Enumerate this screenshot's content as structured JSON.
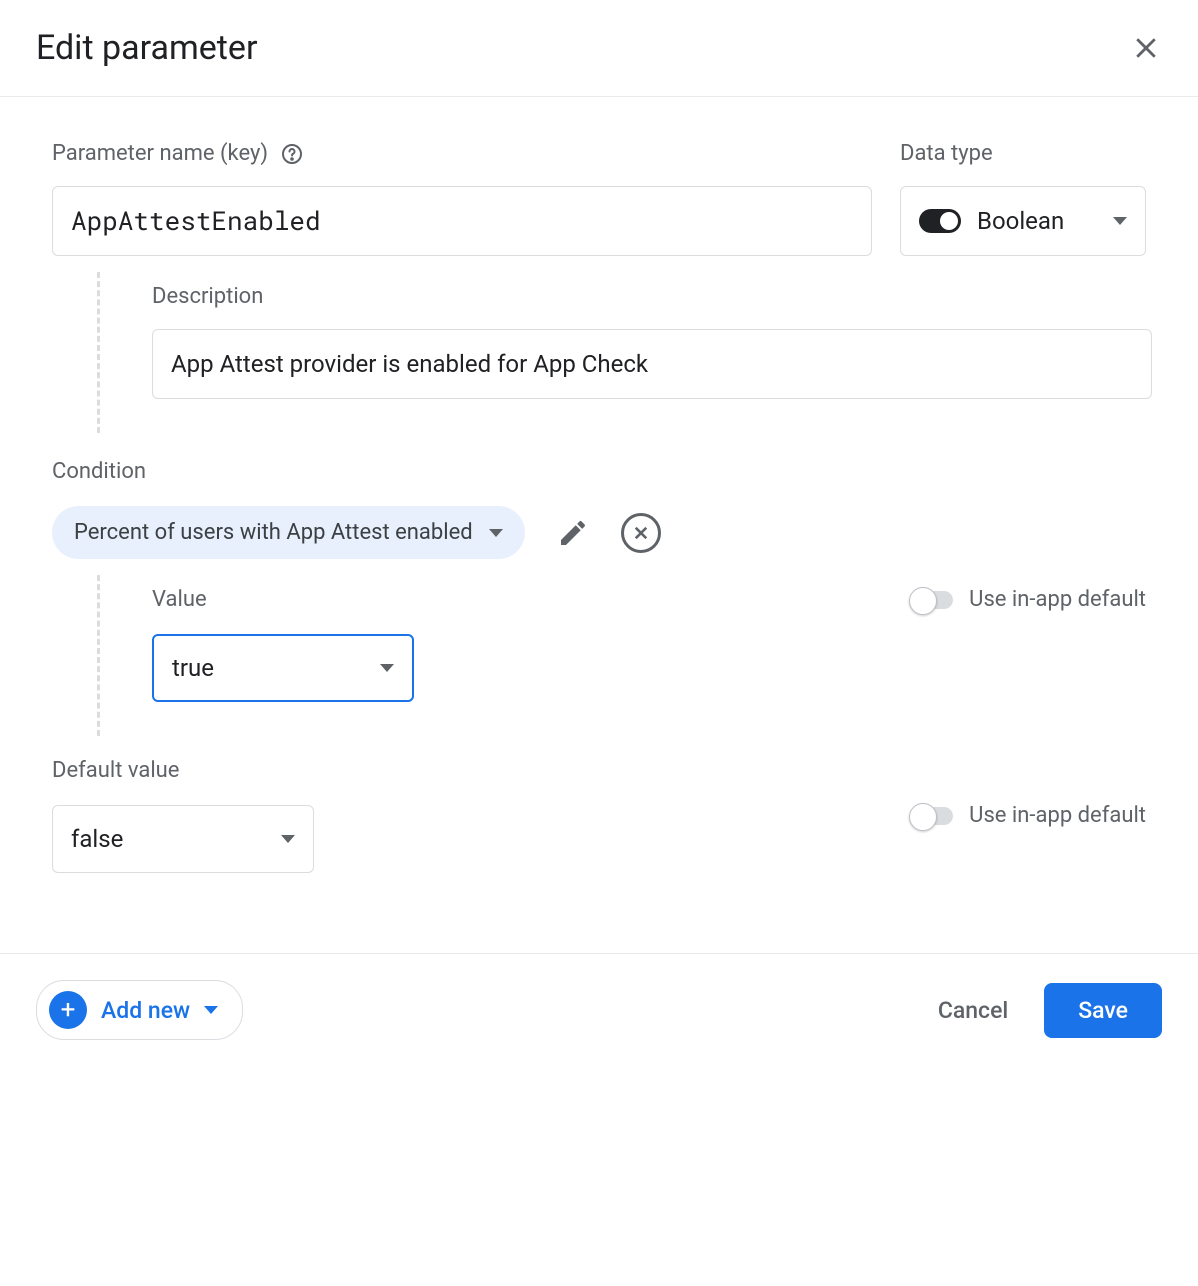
{
  "header": {
    "title": "Edit parameter"
  },
  "param": {
    "name_label": "Parameter name (key)",
    "name_value": "AppAttestEnabled",
    "type_label": "Data type",
    "type_value": "Boolean",
    "desc_label": "Description",
    "desc_value": "App Attest provider is enabled for App Check"
  },
  "condition": {
    "label": "Condition",
    "chip": "Percent of users with App Attest enabled",
    "value_label": "Value",
    "value": "true",
    "use_default_label": "Use in-app default"
  },
  "default": {
    "label": "Default value",
    "value": "false",
    "use_default_label": "Use in-app default"
  },
  "footer": {
    "add_new": "Add new",
    "cancel": "Cancel",
    "save": "Save"
  }
}
